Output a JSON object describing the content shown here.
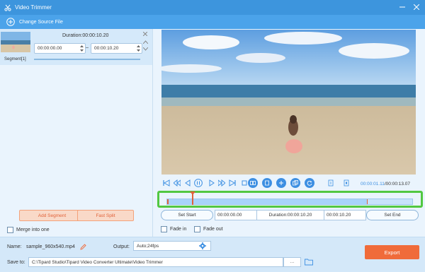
{
  "titlebar": {
    "title": "Video Trimmer",
    "icon": "scissors-icon"
  },
  "source": {
    "label": "Change Source File",
    "icon": "plus-circle-icon"
  },
  "segment": {
    "duration": "Duration:00:00:10.20",
    "start": "00:00:00.00",
    "end": "00:00:10.20",
    "dash": "–",
    "label": "Segment[1]"
  },
  "left_buttons": {
    "add": "Add Segment",
    "split": "Fast Split"
  },
  "merge": {
    "label": "Merge into one",
    "checked": false
  },
  "playback": {
    "current": "00:00:01.11",
    "total": "/00:00:13.07"
  },
  "set_row": {
    "set_start": "Set Start",
    "start": "00:00:00.00",
    "duration": "Duration:00:00:10.20",
    "end": "00:00:10.20",
    "set_end": "Set End"
  },
  "fade": {
    "in": "Fade in",
    "out": "Fade out"
  },
  "output": {
    "name_label": "Name:",
    "name": "sample_960x540.mp4",
    "output_label": "Output:",
    "output_value": "Auto;24fps",
    "save_label": "Save to:",
    "save_path": "C:\\Tipard Studio\\Tipard Video Converter Ultimate\\Video Trimmer",
    "more": "···",
    "export": "Export"
  },
  "colors": {
    "titlebar": "#3d95dd",
    "accent": "#3d8fe2",
    "export": "#f06b3a",
    "highlight": "#52c842"
  }
}
